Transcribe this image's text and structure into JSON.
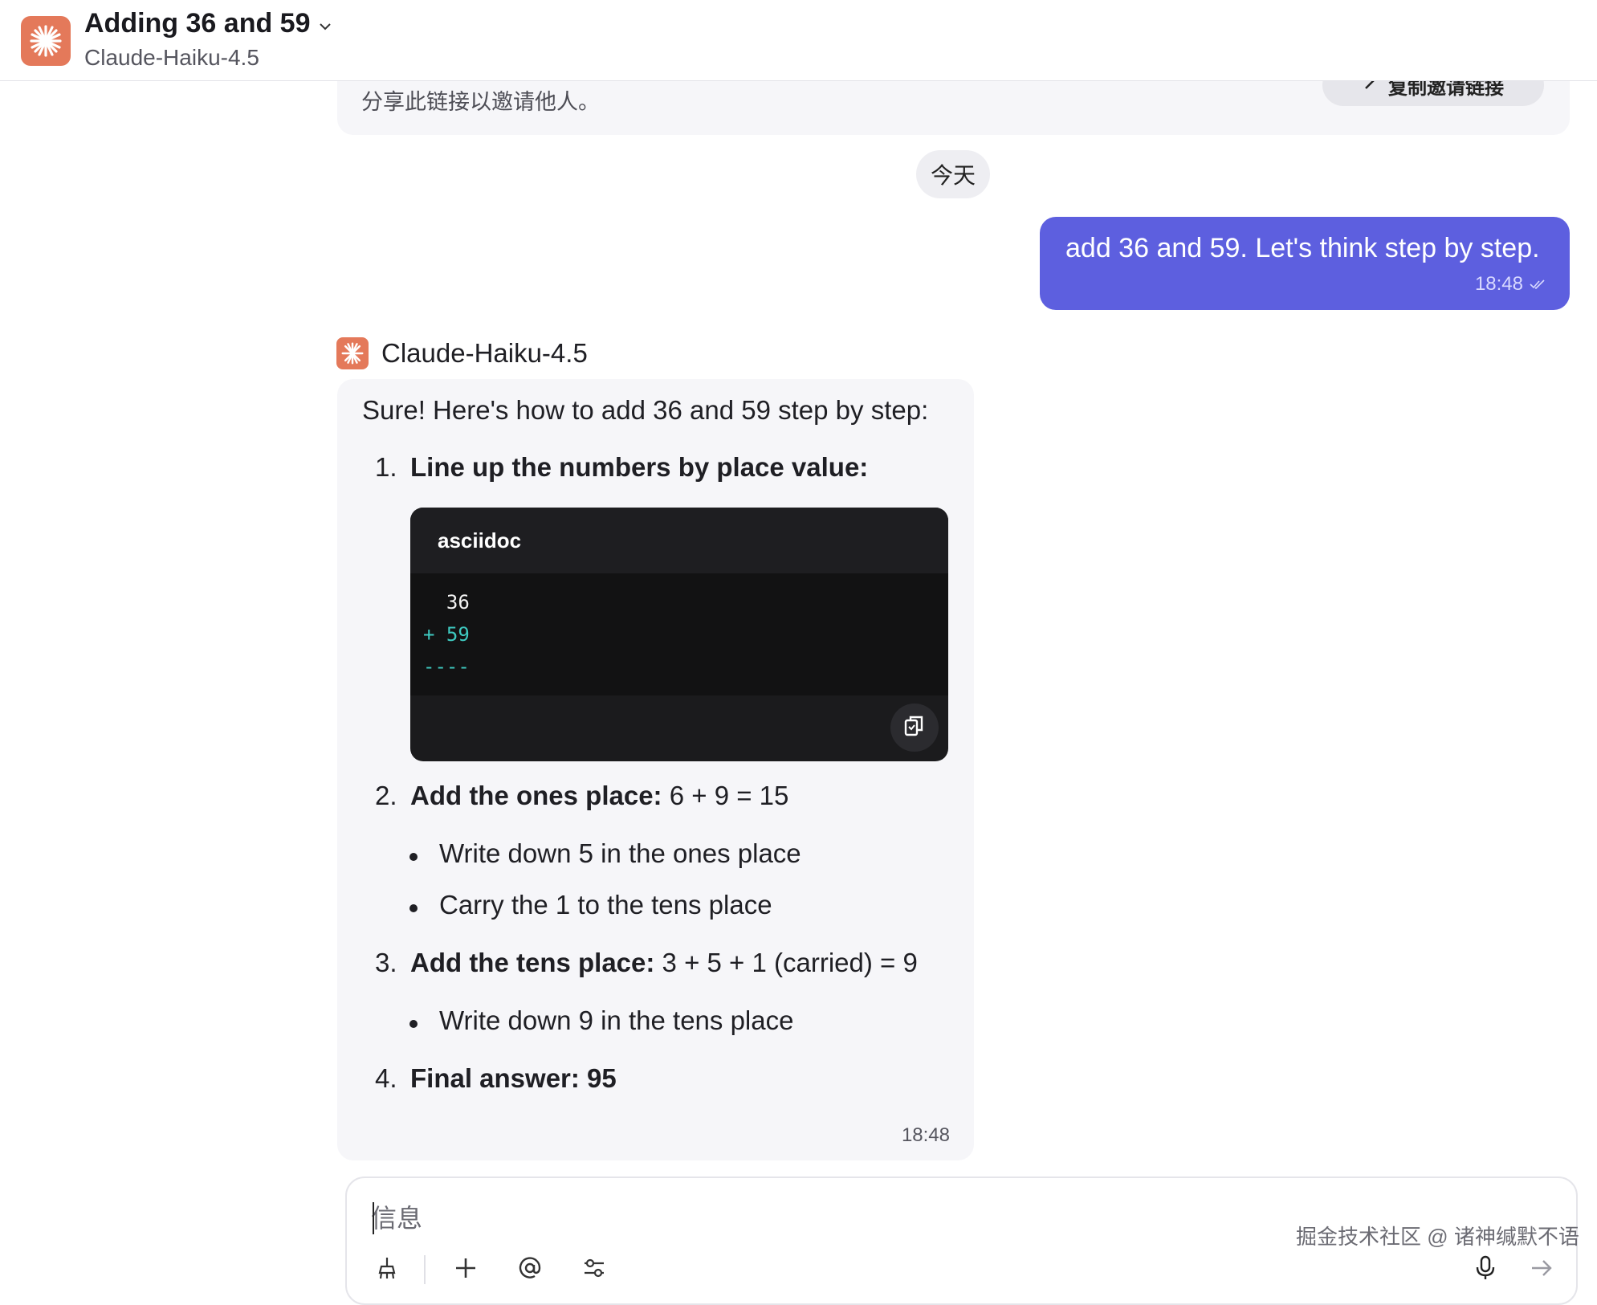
{
  "header": {
    "title": "Adding 36 and 59",
    "subtitle": "Claude-Haiku-4.5"
  },
  "invite": {
    "text": "分享此链接以邀请他人。",
    "button_label": "复制邀请链接"
  },
  "date_separator": "今天",
  "messages": {
    "user": {
      "text": "add 36 and 59. Let's think step by step.",
      "time": "18:48"
    },
    "bot": {
      "name": "Claude-Haiku-4.5",
      "intro": "Sure! Here's how to add 36 and 59 step by step:",
      "steps": [
        {
          "number": "1.",
          "bold": "Line up the numbers by place value:",
          "rest": ""
        },
        {
          "number": "2.",
          "bold": "Add the ones place:",
          "rest": " 6 + 9 = 15"
        },
        {
          "number": "3.",
          "bold": "Add the tens place:",
          "rest": " 3 + 5 + 1 (carried) = 9"
        },
        {
          "number": "4.",
          "bold": "Final answer: 95",
          "rest": ""
        }
      ],
      "step2_bullets": [
        "Write down 5 in the ones place",
        "Carry the 1 to the tens place"
      ],
      "step3_bullets": [
        "Write down 9 in the tens place"
      ],
      "code": {
        "language": "asciidoc",
        "lines": [
          "  36",
          "+ 59",
          "----"
        ]
      },
      "time": "18:48"
    }
  },
  "composer": {
    "placeholder": "信息"
  },
  "watermark": "掘金技术社区 @ 诸神缄默不语",
  "colors": {
    "accent": "#5d5fdf",
    "bot_brand": "#e4795a",
    "code_teal": "#3ec9c0"
  },
  "icons": {
    "bot_logo": "claude-sparkle-icon",
    "copy": "copy-icon",
    "mic": "microphone-icon",
    "send": "arrow-right-icon"
  }
}
